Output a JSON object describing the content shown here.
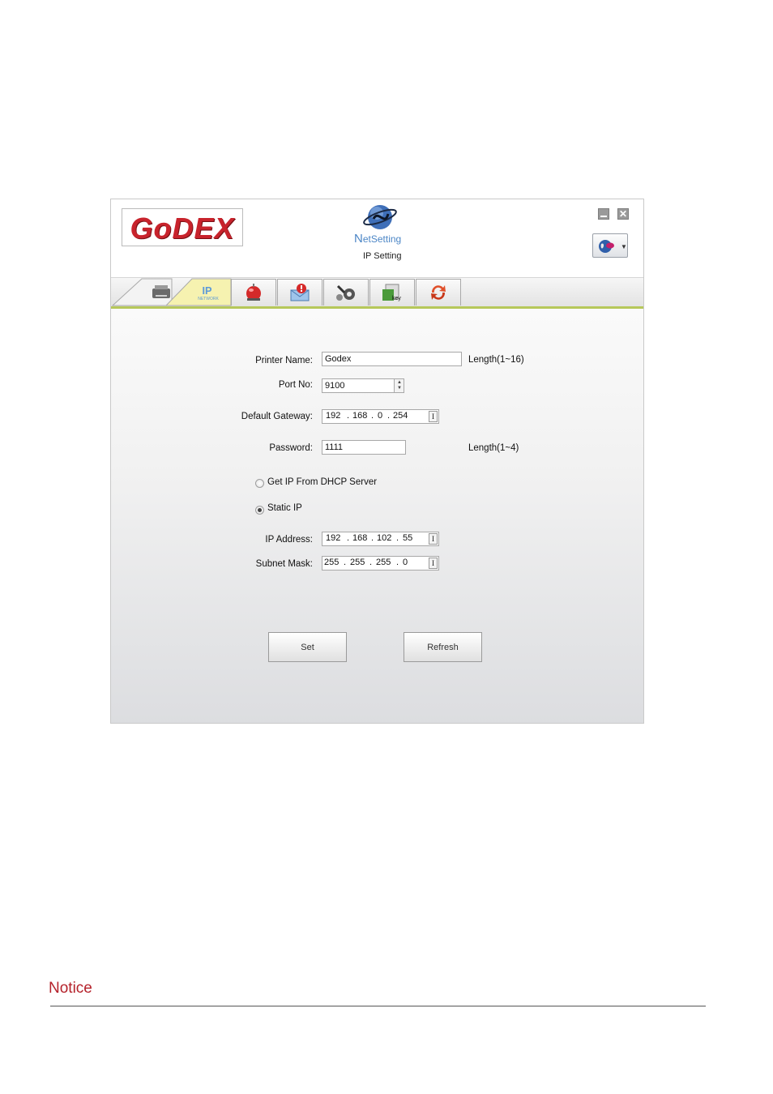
{
  "app": {
    "brand": "GoDEX",
    "product_initial": "N",
    "product_rest": "etSetting",
    "subtitle": "IP Setting",
    "close_glyph": "✕"
  },
  "icons": {
    "tabs": [
      "printer-icon",
      "ip-network-icon",
      "alarm-bell-icon",
      "email-alert-icon",
      "tools-gear-icon",
      "key-config-icon",
      "refresh-icon"
    ],
    "header": [
      "netsetting-globe-icon",
      "minimize-icon",
      "close-icon",
      "language-globe-icon"
    ]
  },
  "tabs": {
    "ip_label": "IP",
    "ip_caption": "NETWORK"
  },
  "form": {
    "printer_name": {
      "label": "Printer Name:",
      "value": "Godex",
      "hint": "Length(1~16)"
    },
    "port": {
      "label": "Port No:",
      "value": "9100"
    },
    "gateway": {
      "label": "Default Gateway:",
      "octets": [
        "192",
        "168",
        "0",
        "254"
      ]
    },
    "password": {
      "label": "Password:",
      "value": "1111",
      "hint": "Length(1~4)"
    },
    "dhcp": {
      "label": "Get IP From DHCP Server",
      "selected": false
    },
    "static": {
      "label": "Static IP",
      "selected": true
    },
    "ip_address": {
      "label": "IP Address:",
      "octets": [
        "192",
        "168",
        "102",
        "55"
      ]
    },
    "subnet": {
      "label": "Subnet Mask:",
      "octets": [
        "255",
        "255",
        "255",
        "0"
      ]
    },
    "ibeam": "I"
  },
  "buttons": {
    "set": "Set",
    "refresh": "Refresh"
  },
  "colors": {
    "brand_red": "#c8232c",
    "accent_green": "#b6c85a",
    "notice_red": "#b5222b",
    "netsetting_blue": "#4c86c6"
  },
  "notice": {
    "title": "Notice"
  }
}
